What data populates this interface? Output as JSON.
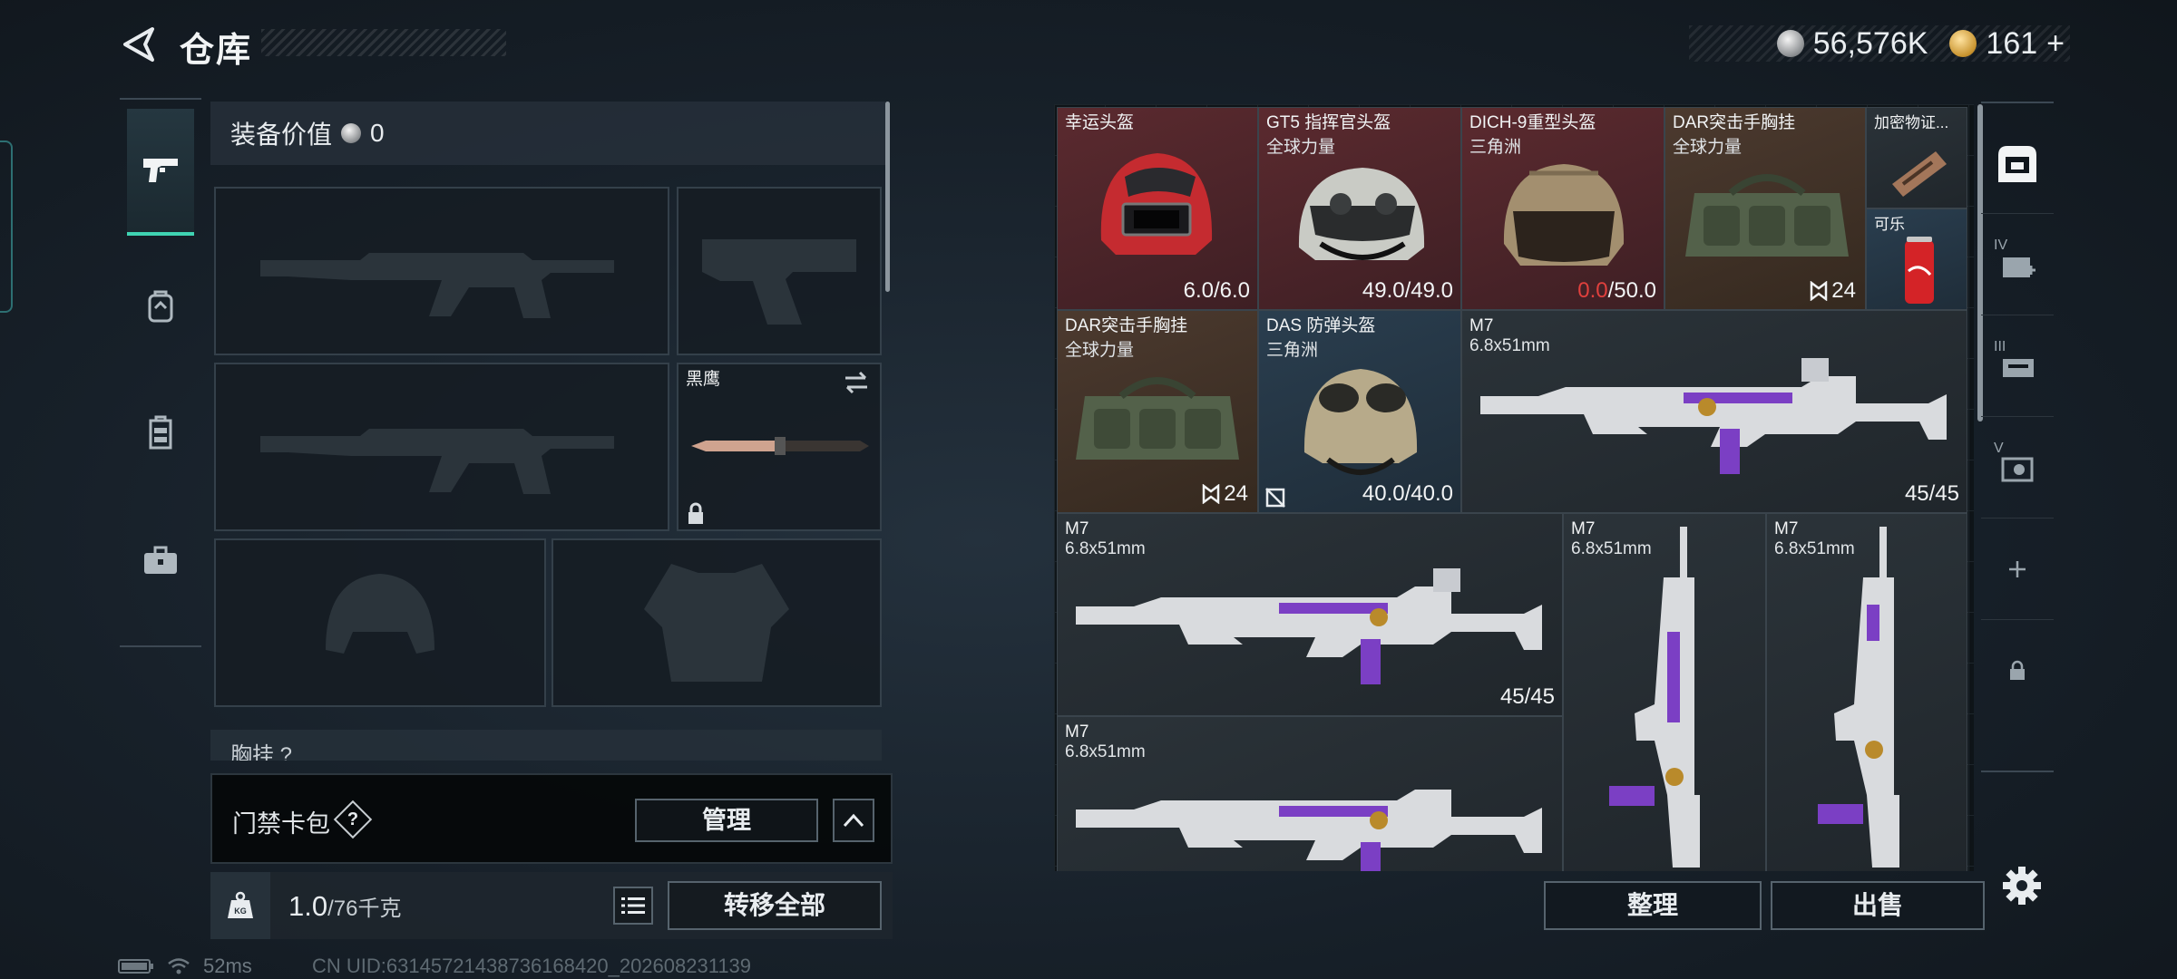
{
  "header": {
    "title": "仓库",
    "silver_amount": "56,576K",
    "gold_amount": "161",
    "gold_plus": "+"
  },
  "loadout": {
    "equip_value_label": "装备价值",
    "equip_value": "0",
    "melee_name": "黑鹰",
    "chest_label": "胸挂",
    "chest_value": "?"
  },
  "keycard": {
    "label": "门禁卡包",
    "help": "?",
    "manage_label": "管理"
  },
  "weight": {
    "current": "1.0",
    "max": "/76千克",
    "transfer_label": "转移全部"
  },
  "status": {
    "ping": "52ms",
    "uid": "CN UID:63145721438736168420_202608231139"
  },
  "stash": {
    "items": [
      {
        "name": "幸运头盔",
        "sub": "",
        "value": "6.0/6.0"
      },
      {
        "name": "GT5 指挥官头盔",
        "sub": "全球力量",
        "value": "49.0/49.0"
      },
      {
        "name": "DICH-9重型头盔",
        "sub": "三角洲",
        "value_damaged": "0.0",
        "value_max": "/50.0"
      },
      {
        "name": "DAR突击手胸挂",
        "sub": "全球力量",
        "stack": "24"
      },
      {
        "name": "加密物证...",
        "sub": ""
      },
      {
        "name": "可乐",
        "sub": ""
      },
      {
        "name": "DAR突击手胸挂",
        "sub": "全球力量",
        "stack": "24"
      },
      {
        "name": "DAS 防弹头盔",
        "sub": "三角洲",
        "value": "40.0/40.0"
      },
      {
        "name": "M7",
        "sub": "6.8x51mm",
        "value": "45/45"
      },
      {
        "name": "M7",
        "sub": "6.8x51mm",
        "value": "45/45"
      },
      {
        "name": "M7",
        "sub": "6.8x51mm"
      },
      {
        "name": "M7",
        "sub": "6.8x51mm"
      },
      {
        "name": "M7",
        "sub": "6.8x51mm"
      }
    ],
    "sort_label": "整理",
    "sell_label": "出售"
  },
  "right_tabs": [
    "IV",
    "III",
    "V"
  ],
  "colors": {
    "accent": "#3fd3b2",
    "damaged": "#e0403d",
    "rarity_red": "#5b2a2f",
    "rarity_brown": "#4c3a2f",
    "rarity_blue": "#2a3e4f",
    "rarity_purple": "#3a3450"
  },
  "icons": [
    "back-arrow-icon",
    "pistol-icon",
    "backpack-icon",
    "vest-icon",
    "briefcase-icon",
    "swap-icon",
    "lock-icon",
    "question-icon",
    "chevron-up-icon",
    "kg-weight-icon",
    "list-icon",
    "safebox-icon",
    "plus-icon",
    "gear-icon",
    "battery-icon",
    "wifi-icon"
  ]
}
